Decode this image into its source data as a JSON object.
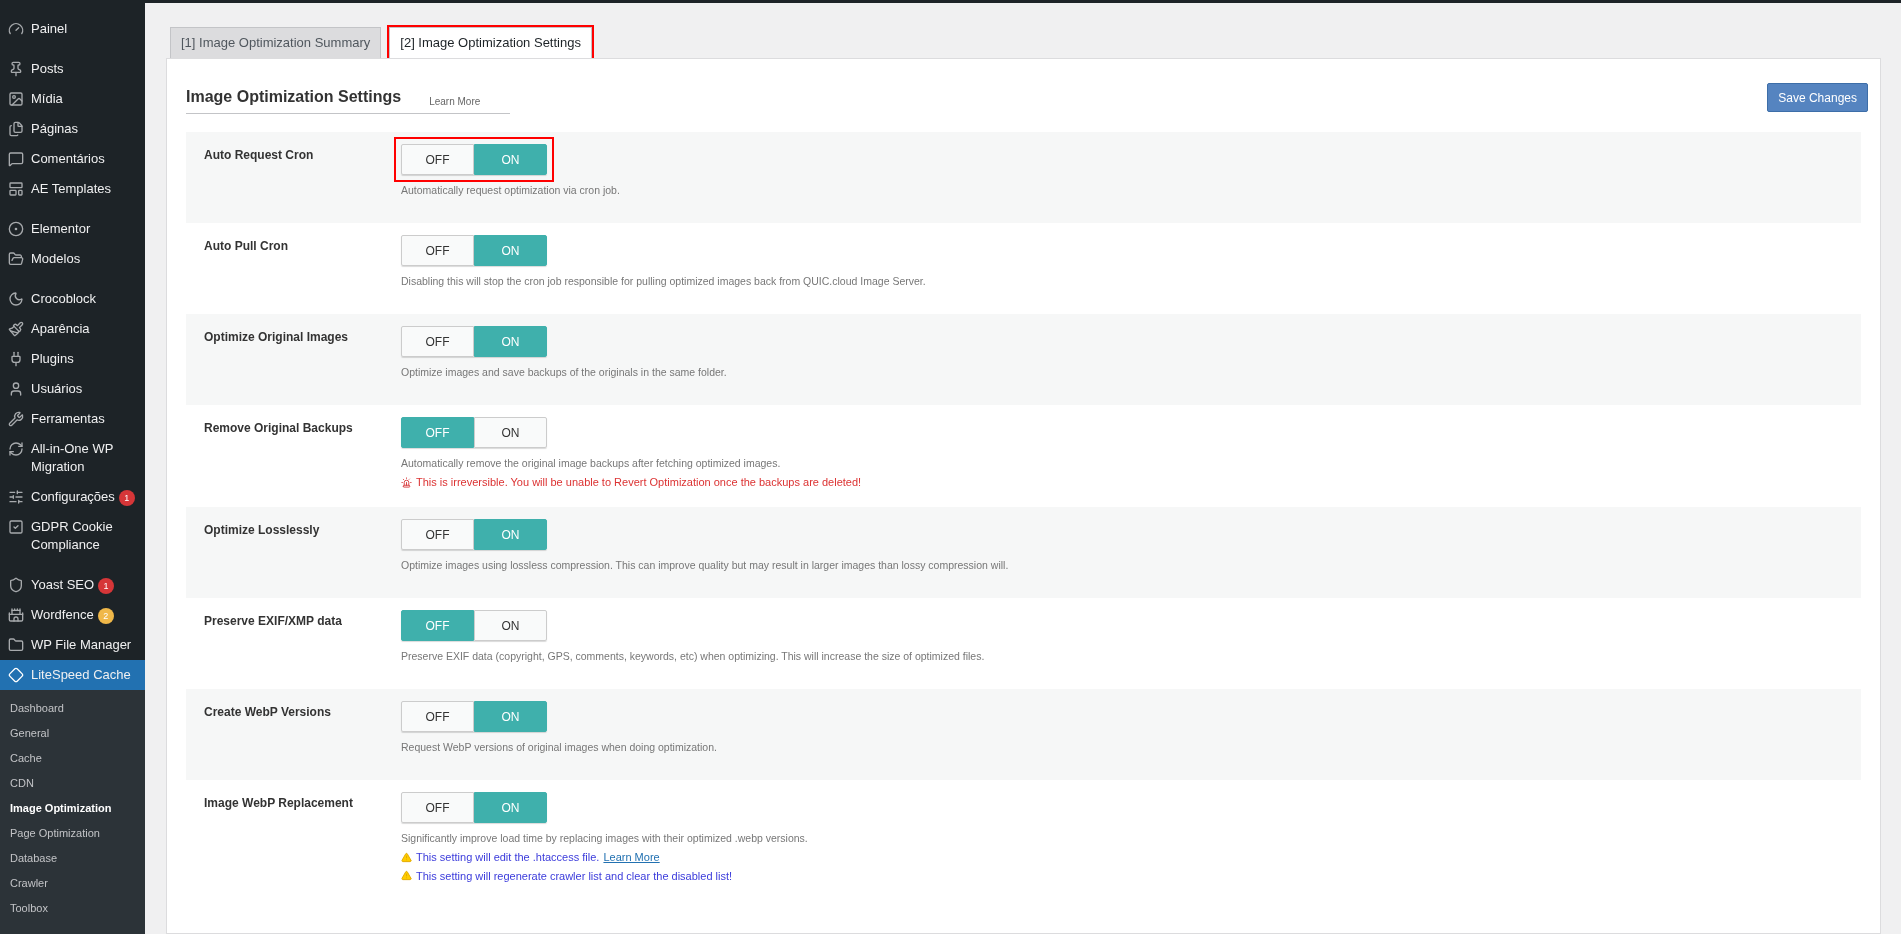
{
  "sidebar": {
    "groups": [
      [
        {
          "label": "Painel",
          "selected": false
        }
      ],
      [
        {
          "label": "Posts",
          "selected": false
        },
        {
          "label": "Mídia",
          "selected": false
        },
        {
          "label": "Páginas",
          "selected": false
        },
        {
          "label": "Comentários",
          "selected": false
        },
        {
          "label": "AE Templates",
          "selected": false
        }
      ],
      [
        {
          "label": "Elementor",
          "selected": false
        },
        {
          "label": "Modelos",
          "selected": false
        }
      ],
      [
        {
          "label": "Crocoblock",
          "selected": false
        },
        {
          "label": "Aparência",
          "selected": false
        },
        {
          "label": "Plugins",
          "selected": false
        },
        {
          "label": "Usuários",
          "selected": false
        },
        {
          "label": "Ferramentas",
          "selected": false
        },
        {
          "label": "All-in-One WP Migration",
          "selected": false
        },
        {
          "label": "Configurações",
          "selected": false,
          "badge": "1",
          "color": "#d63638"
        },
        {
          "label": "GDPR Cookie Compliance",
          "selected": false
        }
      ],
      [
        {
          "label": "Yoast SEO",
          "selected": false,
          "badge": "1",
          "color": "#d63638"
        },
        {
          "label": "Wordfence",
          "selected": false,
          "badge": "2",
          "color": "#f0b849"
        },
        {
          "label": "WP File Manager",
          "selected": false
        },
        {
          "label": "LiteSpeed Cache",
          "selected": true
        }
      ]
    ],
    "submenu": [
      {
        "label": "Dashboard",
        "selected": false
      },
      {
        "label": "General",
        "selected": false
      },
      {
        "label": "Cache",
        "selected": false
      },
      {
        "label": "CDN",
        "selected": false
      },
      {
        "label": "Image Optimization",
        "selected": true
      },
      {
        "label": "Page Optimization",
        "selected": false
      },
      {
        "label": "Database",
        "selected": false
      },
      {
        "label": "Crawler",
        "selected": false
      },
      {
        "label": "Toolbox",
        "selected": false
      }
    ]
  },
  "tabs": [
    {
      "label": "[1] Image Optimization Summary",
      "selected": false,
      "highlighted": false
    },
    {
      "label": "[2] Image Optimization Settings",
      "selected": true,
      "highlighted": true
    }
  ],
  "section": {
    "title": "Image Optimization Settings",
    "learn_more": "Learn More",
    "save_button": "Save Changes"
  },
  "settings": [
    {
      "label": "Auto Request Cron",
      "off_label": "OFF",
      "on_label": "ON",
      "on": true,
      "highlighted": true,
      "description": "Automatically request optimization via cron job."
    },
    {
      "label": "Auto Pull Cron",
      "off_label": "OFF",
      "on_label": "ON",
      "on": true,
      "highlighted": false,
      "description": "Disabling this will stop the cron job responsible for pulling optimized images back from QUIC.cloud Image Server."
    },
    {
      "label": "Optimize Original Images",
      "off_label": "OFF",
      "on_label": "ON",
      "on": true,
      "highlighted": false,
      "description": "Optimize images and save backups of the originals in the same folder."
    },
    {
      "label": "Remove Original Backups",
      "off_label": "OFF",
      "on_label": "ON",
      "on": false,
      "highlighted": false,
      "description": "Automatically remove the original image backups after fetching optimized images.",
      "notes": [
        {
          "kind": "danger",
          "text": "This is irreversible. You will be unable to Revert Optimization once the backups are deleted!"
        }
      ]
    },
    {
      "label": "Optimize Losslessly",
      "off_label": "OFF",
      "on_label": "ON",
      "on": true,
      "highlighted": false,
      "description": "Optimize images using lossless compression. This can improve quality but may result in larger images than lossy compression will."
    },
    {
      "label": "Preserve EXIF/XMP data",
      "off_label": "OFF",
      "on_label": "ON",
      "on": false,
      "highlighted": false,
      "description": "Preserve EXIF data (copyright, GPS, comments, keywords, etc) when optimizing. This will increase the size of optimized files."
    },
    {
      "label": "Create WebP Versions",
      "off_label": "OFF",
      "on_label": "ON",
      "on": true,
      "highlighted": false,
      "description": "Request WebP versions of original images when doing optimization."
    },
    {
      "label": "Image WebP Replacement",
      "off_label": "OFF",
      "on_label": "ON",
      "on": true,
      "highlighted": false,
      "description": "Significantly improve load time by replacing images with their optimized .webp versions.",
      "notes": [
        {
          "kind": "warning",
          "text": "This setting will edit the .htaccess file.",
          "link": "Learn More"
        },
        {
          "kind": "warning",
          "text": "This setting will regenerate crawler list and clear the disabled list!"
        }
      ]
    }
  ]
}
